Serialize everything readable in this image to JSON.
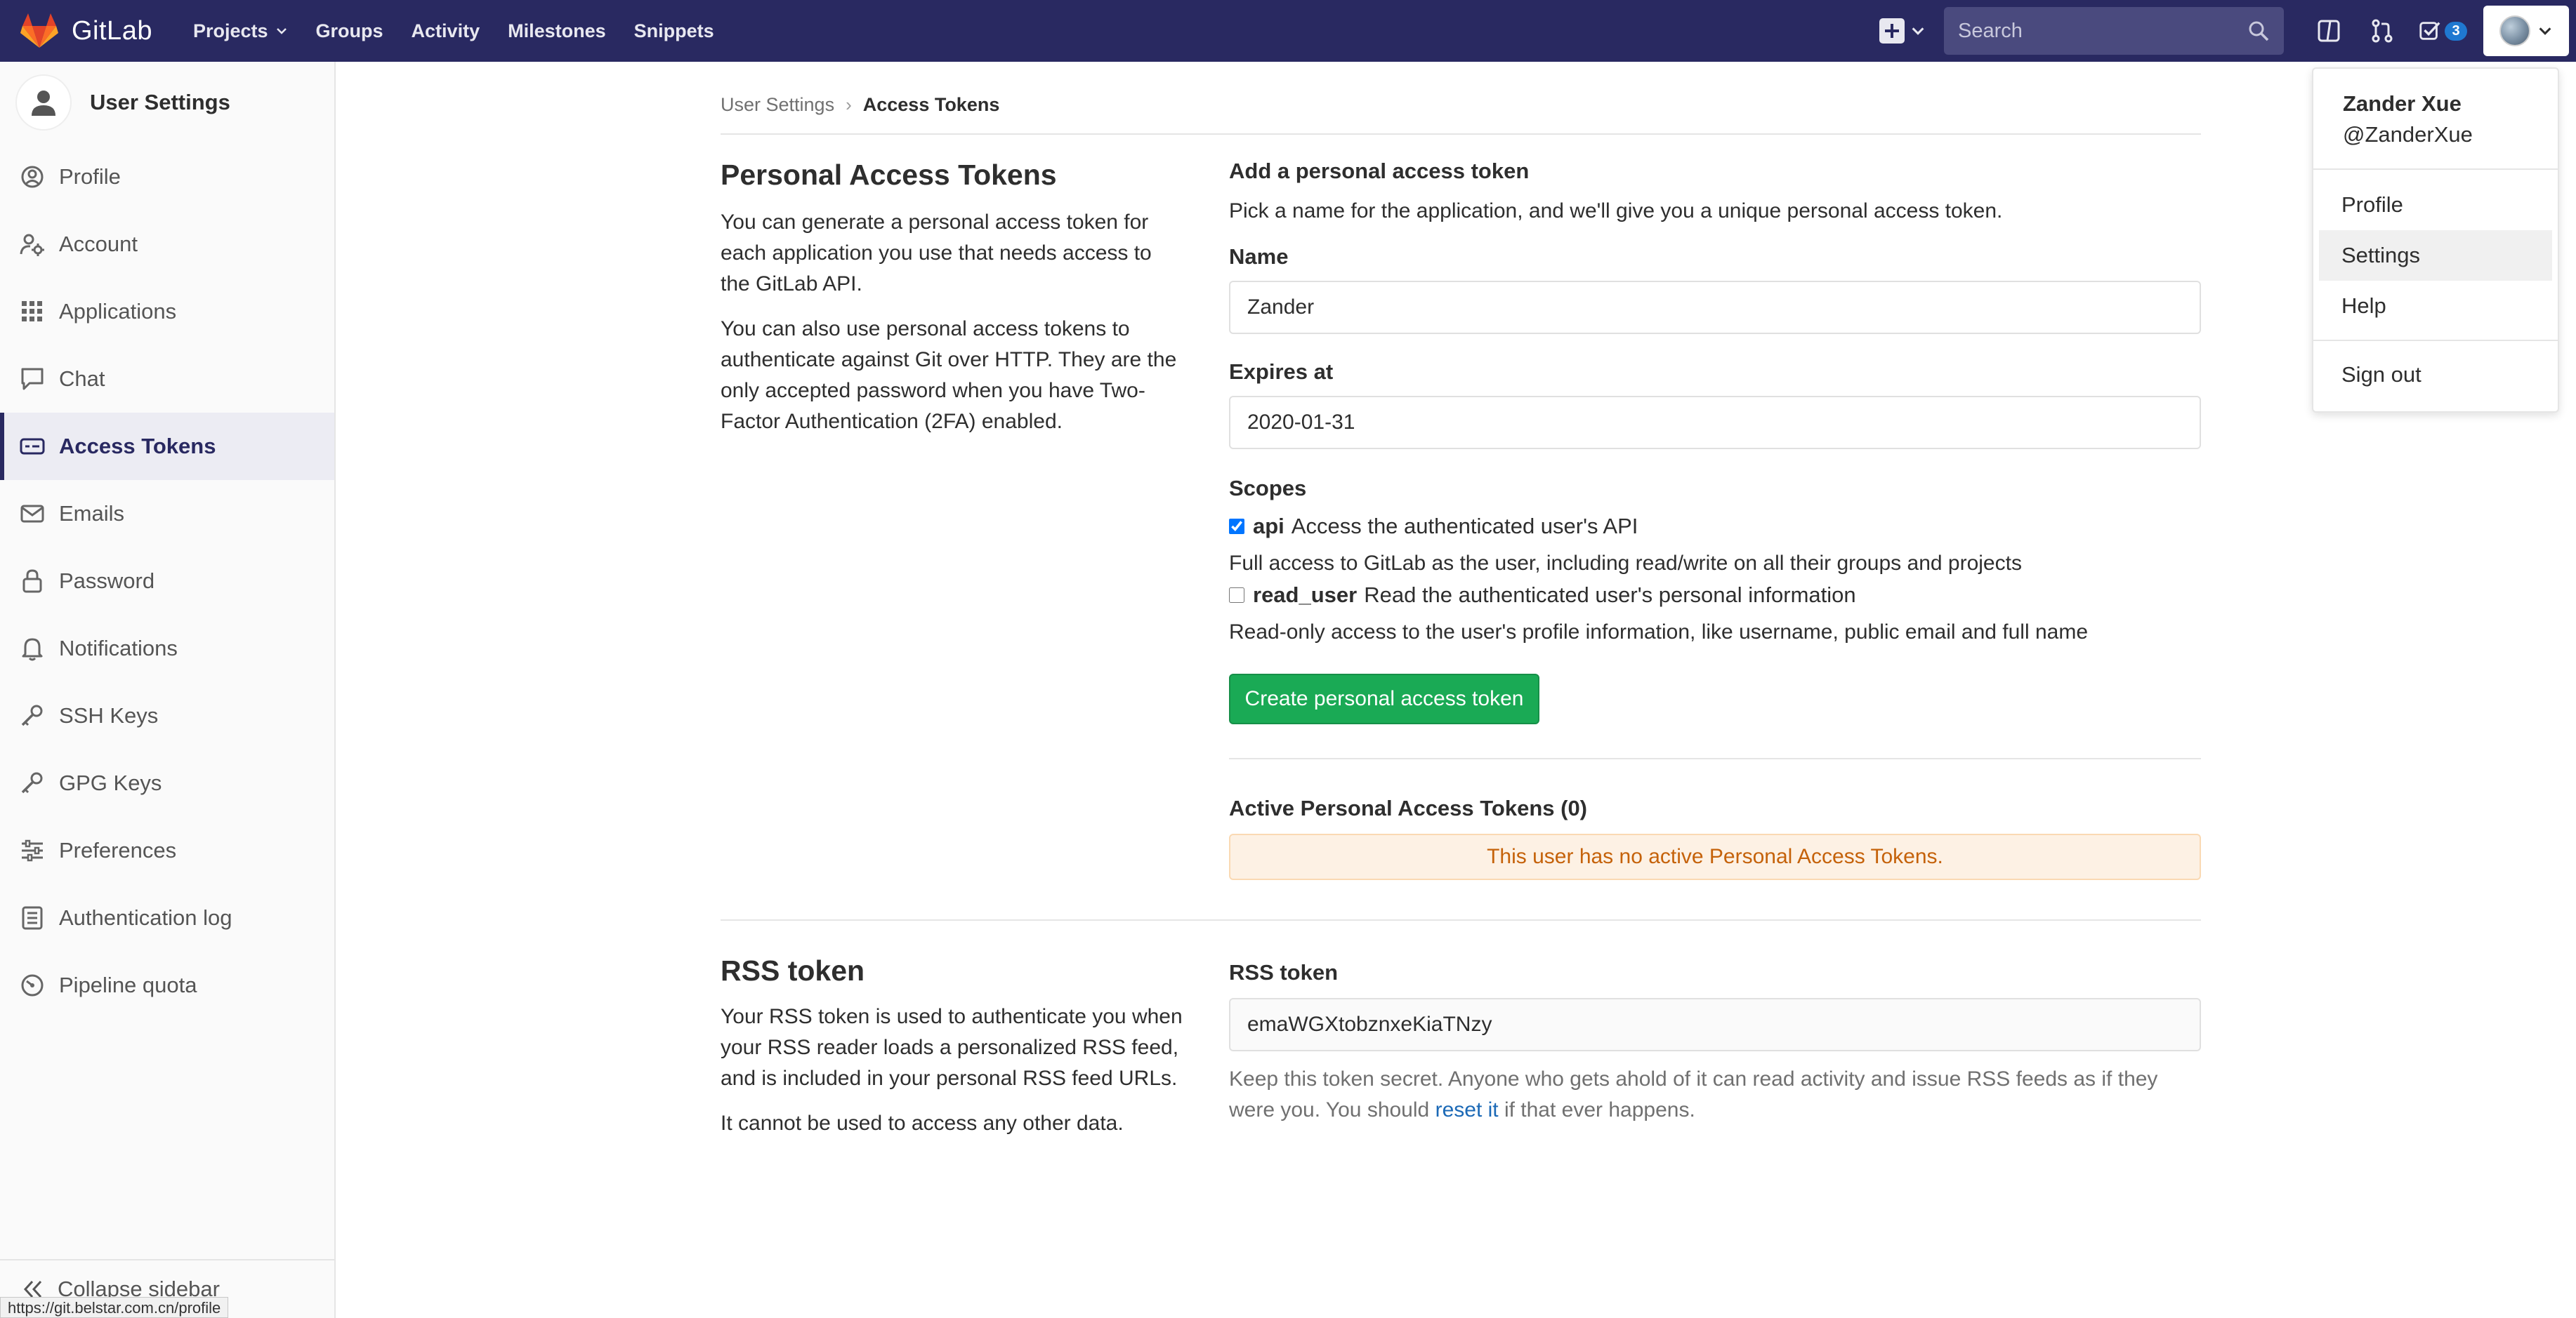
{
  "navbar": {
    "logo_text": "GitLab",
    "links": [
      "Projects",
      "Groups",
      "Activity",
      "Milestones",
      "Snippets"
    ],
    "search_placeholder": "Search",
    "todo_count": "3",
    "icons": [
      "gitlab-tanuki-icon",
      "chevron-down-icon",
      "plus-square-icon",
      "search-icon",
      "sidebar-panel-icon",
      "merge-request-icon",
      "todo-check-icon",
      "user-avatar"
    ]
  },
  "sidebar": {
    "title": "User Settings",
    "items": [
      {
        "label": "Profile",
        "icon": "profile-icon"
      },
      {
        "label": "Account",
        "icon": "account-icon"
      },
      {
        "label": "Applications",
        "icon": "applications-grid-icon"
      },
      {
        "label": "Chat",
        "icon": "chat-icon"
      },
      {
        "label": "Access Tokens",
        "icon": "token-icon",
        "active": true
      },
      {
        "label": "Emails",
        "icon": "email-icon"
      },
      {
        "label": "Password",
        "icon": "lock-icon"
      },
      {
        "label": "Notifications",
        "icon": "bell-icon"
      },
      {
        "label": "SSH Keys",
        "icon": "key-icon"
      },
      {
        "label": "GPG Keys",
        "icon": "key-icon"
      },
      {
        "label": "Preferences",
        "icon": "sliders-icon"
      },
      {
        "label": "Authentication log",
        "icon": "list-icon"
      },
      {
        "label": "Pipeline quota",
        "icon": "gauge-icon"
      }
    ],
    "collapse_label": "Collapse sidebar",
    "status_url": "https://git.belstar.com.cn/profile"
  },
  "breadcrumb": {
    "parent": "User Settings",
    "current": "Access Tokens"
  },
  "pat": {
    "heading": "Personal Access Tokens",
    "desc1": "You can generate a personal access token for each application you use that needs access to the GitLab API.",
    "desc2": "You can also use personal access tokens to authenticate against Git over HTTP. They are the only accepted password when you have Two-Factor Authentication (2FA) enabled.",
    "add_heading": "Add a personal access token",
    "add_desc": "Pick a name for the application, and we'll give you a unique personal access token.",
    "name_label": "Name",
    "name_value": "Zander",
    "expires_label": "Expires at",
    "expires_value": "2020-01-31",
    "scopes_label": "Scopes",
    "scopes": [
      {
        "name": "api",
        "desc": "Access the authenticated user's API",
        "detail": "Full access to GitLab as the user, including read/write on all their groups and projects",
        "checked": true
      },
      {
        "name": "read_user",
        "desc": "Read the authenticated user's personal information",
        "detail": "Read-only access to the user's profile information, like username, public email and full name",
        "checked": false
      }
    ],
    "create_button": "Create personal access token",
    "active_heading": "Active Personal Access Tokens (0)",
    "empty_alert": "This user has no active Personal Access Tokens."
  },
  "rss": {
    "heading": "RSS token",
    "desc1": "Your RSS token is used to authenticate you when your RSS reader loads a personalized RSS feed, and is included in your personal RSS feed URLs.",
    "desc2": "It cannot be used to access any other data.",
    "label": "RSS token",
    "value": "emaWGXtobznxeKiaTNzy",
    "hint_before": "Keep this token secret. Anyone who gets ahold of it can read activity and issue RSS feeds as if they were you. You should",
    "hint_link": "reset it",
    "hint_after": "if that ever happens."
  },
  "dropdown": {
    "name": "Zander Xue",
    "username": "@ZanderXue",
    "items": [
      "Profile",
      "Settings",
      "Help"
    ],
    "active_item": "Settings",
    "sign_out": "Sign out"
  },
  "colors": {
    "navbar": "#292961",
    "create_button": "#1aaa55",
    "alert_text": "#c5620a",
    "link": "#1b69b6"
  }
}
